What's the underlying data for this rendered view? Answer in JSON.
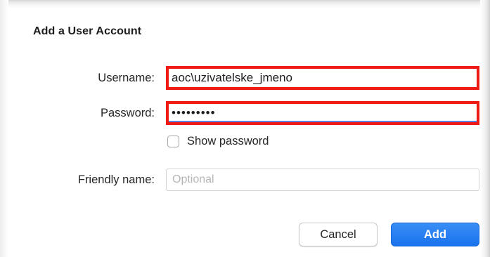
{
  "dialog": {
    "title": "Add a User Account"
  },
  "form": {
    "username": {
      "label": "Username:",
      "value": "aoc\\uzivatelske_jmeno"
    },
    "password": {
      "label": "Password:",
      "value": "•••••••••"
    },
    "show_password": {
      "label": "Show password",
      "checked": false
    },
    "friendly_name": {
      "label": "Friendly name:",
      "value": "",
      "placeholder": "Optional"
    }
  },
  "buttons": {
    "cancel_label": "Cancel",
    "add_label": "Add"
  },
  "colors": {
    "highlight_border": "#ee1b14",
    "accent_blue": "#1a73ee"
  }
}
